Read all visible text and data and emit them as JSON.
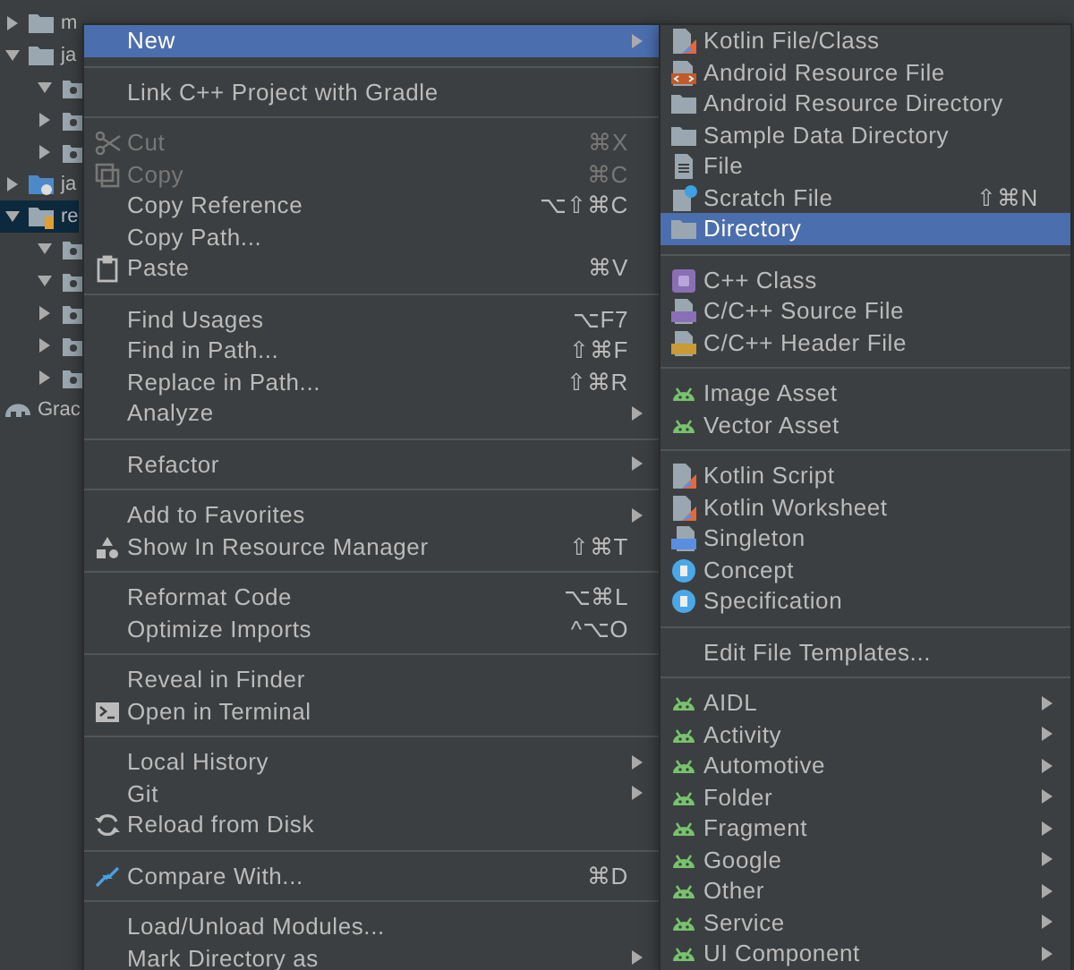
{
  "project_tree": [
    {
      "label": "m",
      "kind": "folder",
      "expanded": false,
      "selected": false
    },
    {
      "label": "ja",
      "kind": "folder",
      "expanded": true,
      "selected": false,
      "children": [
        {
          "kind": "package",
          "expanded": true,
          "selected": false
        },
        {
          "kind": "package",
          "expanded": false,
          "selected": false
        },
        {
          "kind": "package",
          "expanded": false,
          "selected": false
        }
      ]
    },
    {
      "label": "ja",
      "kind": "gen-folder",
      "expanded": false,
      "selected": false
    },
    {
      "label": "re",
      "kind": "res-folder",
      "expanded": true,
      "selected": true,
      "children": [
        {
          "kind": "package",
          "expanded": true,
          "selected": false
        },
        {
          "kind": "package",
          "expanded": true,
          "selected": false
        },
        {
          "kind": "package",
          "expanded": false,
          "selected": false
        },
        {
          "kind": "package",
          "expanded": false,
          "selected": false
        },
        {
          "kind": "package",
          "expanded": false,
          "selected": false
        }
      ]
    },
    {
      "label": "Grac",
      "kind": "gradle",
      "selected": false
    }
  ],
  "menu": {
    "groups": [
      {
        "items": [
          {
            "label": "New",
            "submenu": true,
            "selected": true,
            "disabled": false
          }
        ]
      },
      {
        "items": [
          {
            "label": "Link C++ Project with Gradle",
            "selected": false,
            "disabled": false
          }
        ]
      },
      {
        "items": [
          {
            "label": "Cut",
            "kind": "scissors",
            "shortcut": "⌘X",
            "selected": false,
            "disabled": true
          },
          {
            "label": "Copy",
            "kind": "copy",
            "shortcut": "⌘C",
            "selected": false,
            "disabled": true
          },
          {
            "label": "Copy Reference",
            "shortcut": "⌥⇧⌘C",
            "selected": false,
            "disabled": false
          },
          {
            "label": "Copy Path...",
            "selected": false,
            "disabled": false
          },
          {
            "label": "Paste",
            "kind": "clipboard",
            "shortcut": "⌘V",
            "selected": false,
            "disabled": false
          }
        ]
      },
      {
        "items": [
          {
            "label": "Find Usages",
            "shortcut": "⌥F7",
            "selected": false,
            "disabled": false
          },
          {
            "label": "Find in Path...",
            "shortcut": "⇧⌘F",
            "selected": false,
            "disabled": false
          },
          {
            "label": "Replace in Path...",
            "shortcut": "⇧⌘R",
            "selected": false,
            "disabled": false
          },
          {
            "label": "Analyze",
            "submenu": true,
            "selected": false,
            "disabled": false
          }
        ]
      },
      {
        "items": [
          {
            "label": "Refactor",
            "submenu": true,
            "selected": false,
            "disabled": false
          }
        ]
      },
      {
        "items": [
          {
            "label": "Add to Favorites",
            "submenu": true,
            "selected": false,
            "disabled": false
          },
          {
            "label": "Show In Resource Manager",
            "kind": "shapes",
            "shortcut": "⇧⌘T",
            "selected": false,
            "disabled": false
          }
        ]
      },
      {
        "items": [
          {
            "label": "Reformat Code",
            "shortcut": "⌥⌘L",
            "selected": false,
            "disabled": false
          },
          {
            "label": "Optimize Imports",
            "shortcut": "^⌥O",
            "selected": false,
            "disabled": false
          }
        ]
      },
      {
        "items": [
          {
            "label": "Reveal in Finder",
            "selected": false,
            "disabled": false
          },
          {
            "label": "Open in Terminal",
            "kind": "terminal",
            "selected": false,
            "disabled": false
          }
        ]
      },
      {
        "items": [
          {
            "label": "Local History",
            "submenu": true,
            "selected": false,
            "disabled": false
          },
          {
            "label": "Git",
            "submenu": true,
            "selected": false,
            "disabled": false
          },
          {
            "label": "Reload from Disk",
            "kind": "reload",
            "selected": false,
            "disabled": false
          }
        ]
      },
      {
        "items": [
          {
            "label": "Compare With...",
            "kind": "compare",
            "shortcut": "⌘D",
            "selected": false,
            "disabled": false
          }
        ]
      },
      {
        "items": [
          {
            "label": "Load/Unload Modules...",
            "selected": false,
            "disabled": false
          },
          {
            "label": "Mark Directory as",
            "submenu": true,
            "selected": false,
            "disabled": false
          }
        ]
      }
    ]
  },
  "new_submenu": {
    "groups": [
      {
        "items": [
          {
            "label": "Kotlin File/Class",
            "kind": "kotlin",
            "selected": false,
            "disabled": false
          },
          {
            "label": "Android Resource File",
            "kind": "res-file",
            "selected": false,
            "disabled": false
          },
          {
            "label": "Android Resource Directory",
            "kind": "folder",
            "selected": false,
            "disabled": false
          },
          {
            "label": "Sample Data Directory",
            "kind": "folder",
            "selected": false,
            "disabled": false
          },
          {
            "label": "File",
            "kind": "file",
            "selected": false,
            "disabled": false
          },
          {
            "label": "Scratch File",
            "kind": "scratch",
            "shortcut": "⇧⌘N",
            "selected": false,
            "disabled": false
          },
          {
            "label": "Directory",
            "kind": "folder",
            "selected": true,
            "disabled": false
          }
        ]
      },
      {
        "items": [
          {
            "label": "C++ Class",
            "kind": "cpp-class",
            "selected": false,
            "disabled": false
          },
          {
            "label": "C/C++ Source File",
            "kind": "cpp-source",
            "selected": false,
            "disabled": false
          },
          {
            "label": "C/C++ Header File",
            "kind": "cpp-header",
            "selected": false,
            "disabled": false
          }
        ]
      },
      {
        "items": [
          {
            "label": "Image Asset",
            "kind": "android",
            "selected": false,
            "disabled": false
          },
          {
            "label": "Vector Asset",
            "kind": "android",
            "selected": false,
            "disabled": false
          }
        ]
      },
      {
        "items": [
          {
            "label": "Kotlin Script",
            "kind": "kotlin",
            "selected": false,
            "disabled": false
          },
          {
            "label": "Kotlin Worksheet",
            "kind": "kotlin",
            "selected": false,
            "disabled": false
          },
          {
            "label": "Singleton",
            "kind": "singleton",
            "selected": false,
            "disabled": false
          },
          {
            "label": "Concept",
            "kind": "concept",
            "selected": false,
            "disabled": false
          },
          {
            "label": "Specification",
            "kind": "concept",
            "selected": false,
            "disabled": false
          }
        ]
      },
      {
        "items": [
          {
            "label": "Edit File Templates...",
            "selected": false,
            "disabled": false
          }
        ]
      },
      {
        "items": [
          {
            "label": "AIDL",
            "kind": "android",
            "submenu": true,
            "selected": false,
            "disabled": false
          },
          {
            "label": "Activity",
            "kind": "android",
            "submenu": true,
            "selected": false,
            "disabled": false
          },
          {
            "label": "Automotive",
            "kind": "android",
            "submenu": true,
            "selected": false,
            "disabled": false
          },
          {
            "label": "Folder",
            "kind": "android",
            "submenu": true,
            "selected": false,
            "disabled": false
          },
          {
            "label": "Fragment",
            "kind": "android",
            "submenu": true,
            "selected": false,
            "disabled": false
          },
          {
            "label": "Google",
            "kind": "android",
            "submenu": true,
            "selected": false,
            "disabled": false
          },
          {
            "label": "Other",
            "kind": "android",
            "submenu": true,
            "selected": false,
            "disabled": false
          },
          {
            "label": "Service",
            "kind": "android",
            "submenu": true,
            "selected": false,
            "disabled": false
          },
          {
            "label": "UI Component",
            "kind": "android",
            "submenu": true,
            "selected": false,
            "disabled": false
          }
        ]
      }
    ]
  }
}
